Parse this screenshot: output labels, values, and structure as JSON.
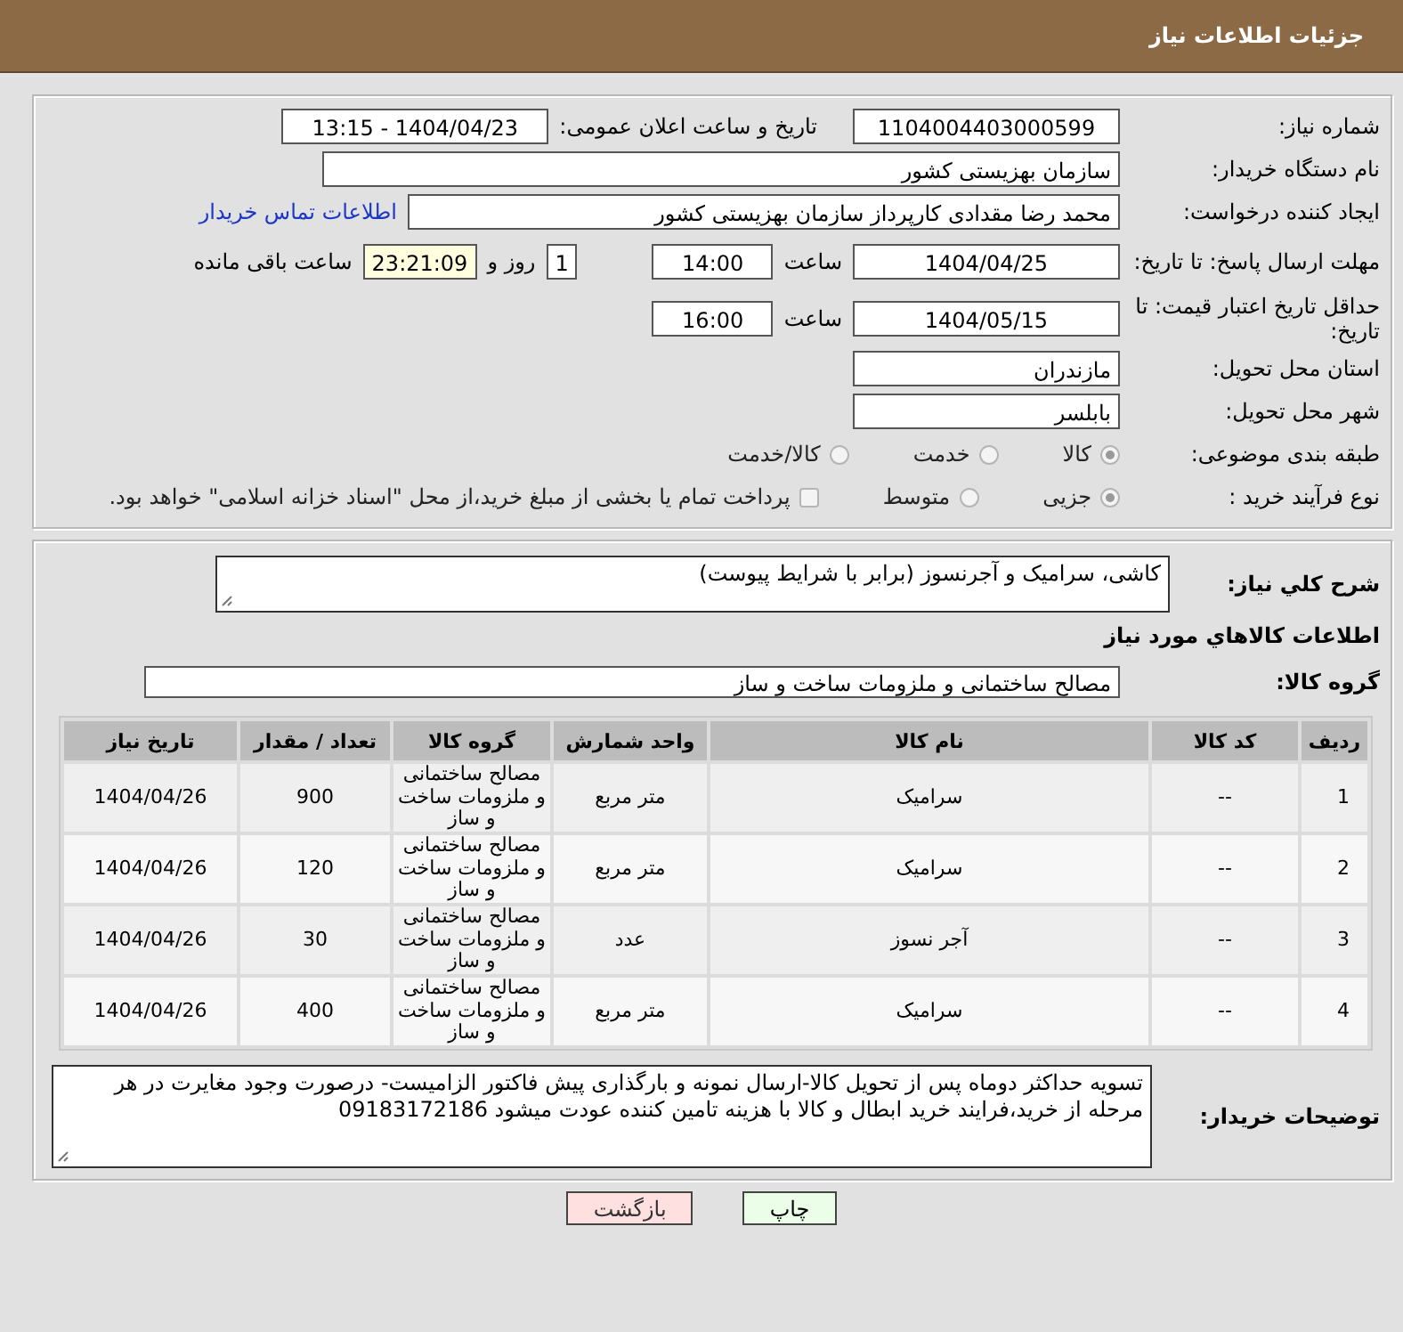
{
  "header": {
    "title": "جزئیات اطلاعات نیاز"
  },
  "details": {
    "need_number": {
      "label": "شماره نیاز:",
      "value": "1104004403000599"
    },
    "announce": {
      "label": "تاریخ و ساعت اعلان عمومی:",
      "value": "1404/04/23 - 13:15"
    },
    "buyer_org": {
      "label": "نام دستگاه خریدار:",
      "value": "سازمان بهزیستی کشور"
    },
    "requester": {
      "label": "ایجاد کننده درخواست:",
      "value": "محمد رضا  مقدادی کارپرداز سازمان بهزیستی کشور"
    },
    "contact_link": "اطلاعات تماس خریدار",
    "deadline": {
      "label": "مهلت ارسال پاسخ: تا تاریخ:",
      "date": "1404/04/25",
      "time_label": "ساعت",
      "time": "14:00",
      "days": "1",
      "days_label": "روز و",
      "remaining": "23:21:09",
      "remaining_label": "ساعت باقی مانده"
    },
    "validity": {
      "label": "حداقل تاریخ اعتبار قیمت: تا تاریخ:",
      "date": "1404/05/15",
      "time_label": "ساعت",
      "time": "16:00"
    },
    "province": {
      "label": "استان محل تحویل:",
      "value": "مازندران"
    },
    "city": {
      "label": "شهر محل تحویل:",
      "value": "بابلسر"
    },
    "category": {
      "label": "طبقه بندی موضوعی:",
      "options": [
        {
          "label": "کالا",
          "selected": true
        },
        {
          "label": "خدمت",
          "selected": false
        },
        {
          "label": "کالا/خدمت",
          "selected": false
        }
      ]
    },
    "process": {
      "label": "نوع فرآیند خرید :",
      "options": [
        {
          "label": "جزیی",
          "selected": true
        },
        {
          "label": "متوسط",
          "selected": false
        }
      ],
      "payment_note": {
        "label": "پرداخت تمام یا بخشی از مبلغ خرید،از محل \"اسناد خزانه اسلامی\" خواهد بود.",
        "checked": false
      }
    }
  },
  "needs": {
    "description": {
      "label": "شرح كلي نياز:",
      "value": "کاشی، سرامیک و آجرنسوز (برابر با شرایط پیوست)"
    },
    "items_heading": "اطلاعات كالاهاي مورد نياز",
    "group": {
      "label": "گروه كالا:",
      "value": "مصالح ساختمانی و ملزومات ساخت و ساز"
    },
    "table": {
      "columns": [
        "ردیف",
        "کد کالا",
        "نام کالا",
        "واحد شمارش",
        "گروه کالا",
        "تعداد / مقدار",
        "تاریخ نیاز"
      ],
      "rows": [
        [
          "1",
          "--",
          "سرامیک",
          "متر مربع",
          "مصالح ساختمانی و ملزومات ساخت و ساز",
          "900",
          "1404/04/26"
        ],
        [
          "2",
          "--",
          "سرامیک",
          "متر مربع",
          "مصالح ساختمانی و ملزومات ساخت و ساز",
          "120",
          "1404/04/26"
        ],
        [
          "3",
          "--",
          "آجر نسوز",
          "عدد",
          "مصالح ساختمانی و ملزومات ساخت و ساز",
          "30",
          "1404/04/26"
        ],
        [
          "4",
          "--",
          "سرامیک",
          "متر مربع",
          "مصالح ساختمانی و ملزومات ساخت و ساز",
          "400",
          "1404/04/26"
        ]
      ]
    },
    "buyer_notes": {
      "label": "توضیحات خریدار:",
      "value": "تسویه حداکثر دوماه پس از تحویل کالا-ارسال نمونه و بارگذاری پیش فاکتور الزامیست- درصورت وجود مغایرت در هر مرحله از خرید،فرایند خرید ابطال و کالا با هزینه تامین کننده عودت میشود 09183172186"
    }
  },
  "buttons": [
    {
      "label": "چاپ",
      "kind": "print"
    },
    {
      "label": "بازگشت",
      "kind": "back"
    }
  ]
}
